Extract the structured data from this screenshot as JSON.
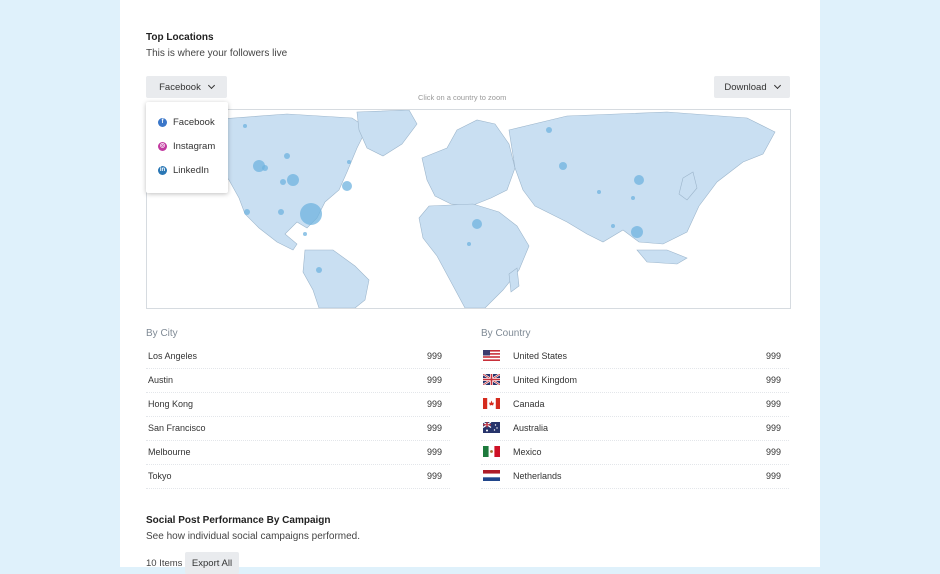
{
  "top_locations": {
    "title": "Top Locations",
    "subtitle": "This is where your followers live",
    "network_select": "Facebook",
    "download_label": "Download",
    "map_hint": "Click on a country to zoom",
    "network_options": [
      {
        "label": "Facebook",
        "icon": "facebook-icon",
        "color": "#3b77c9"
      },
      {
        "label": "Instagram",
        "icon": "instagram-icon",
        "color": "#c23aa0"
      },
      {
        "label": "LinkedIn",
        "icon": "linkedin-icon",
        "color": "#2a77b5"
      }
    ]
  },
  "by_city": {
    "title": "By City",
    "rows": [
      {
        "name": "Los Angeles",
        "value": "999"
      },
      {
        "name": "Austin",
        "value": "999"
      },
      {
        "name": "Hong Kong",
        "value": "999"
      },
      {
        "name": "San Francisco",
        "value": "999"
      },
      {
        "name": "Melbourne",
        "value": "999"
      },
      {
        "name": "Tokyo",
        "value": "999"
      }
    ]
  },
  "by_country": {
    "title": "By Country",
    "rows": [
      {
        "name": "United States",
        "value": "999",
        "flag": "us-flag-icon"
      },
      {
        "name": "United Kingdom",
        "value": "999",
        "flag": "uk-flag-icon"
      },
      {
        "name": "Canada",
        "value": "999",
        "flag": "canada-flag-icon"
      },
      {
        "name": "Australia",
        "value": "999",
        "flag": "australia-flag-icon"
      },
      {
        "name": "Mexico",
        "value": "999",
        "flag": "mexico-flag-icon"
      },
      {
        "name": "Netherlands",
        "value": "999",
        "flag": "netherlands-flag-icon"
      }
    ]
  },
  "campaign": {
    "title": "Social Post Performance By Campaign",
    "subtitle": "See how individual social campaigns performed.",
    "items_count": "10 Items",
    "export_label": "Export All"
  },
  "colors": {
    "page_bg": "#dff1fb",
    "land": "#c9dff2",
    "bubble": "#6fb3df"
  }
}
